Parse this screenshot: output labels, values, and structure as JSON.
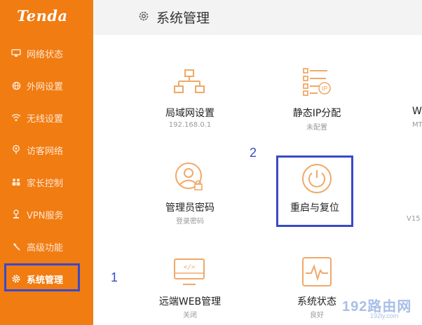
{
  "sidebar": {
    "logo": "Tenda",
    "items": [
      {
        "label": "网络状态"
      },
      {
        "label": "外网设置"
      },
      {
        "label": "无线设置"
      },
      {
        "label": "访客网络"
      },
      {
        "label": "家长控制"
      },
      {
        "label": "VPN服务"
      },
      {
        "label": "高级功能"
      },
      {
        "label": "系统管理",
        "active": true
      }
    ]
  },
  "header": {
    "title": "系统管理"
  },
  "tiles": [
    {
      "title": "局域网设置",
      "sub": "192.168.0.1",
      "icon": "network-topology-icon"
    },
    {
      "title": "静态IP分配",
      "sub": "未配置",
      "icon": "static-ip-icon"
    },
    {
      "title": "W",
      "sub": "MT",
      "icon": "partial"
    },
    {
      "title": "管理员密码",
      "sub": "登录密码",
      "icon": "user-lock-icon"
    },
    {
      "title": "重启与复位",
      "sub": "",
      "icon": "power-icon"
    },
    {
      "title": "",
      "sub": "V15",
      "icon": "partial"
    },
    {
      "title": "远端WEB管理",
      "sub": "关闭",
      "icon": "monitor-code-icon"
    },
    {
      "title": "系统状态",
      "sub": "良好",
      "icon": "pulse-monitor-icon"
    }
  ],
  "annotations": {
    "step1": "1",
    "step2": "2"
  },
  "watermark": {
    "text": "192路由网",
    "sub": "192ly.com"
  },
  "colors": {
    "sidebar": "#f07c12",
    "icon": "#f0a868",
    "highlight": "#3a49c9"
  }
}
